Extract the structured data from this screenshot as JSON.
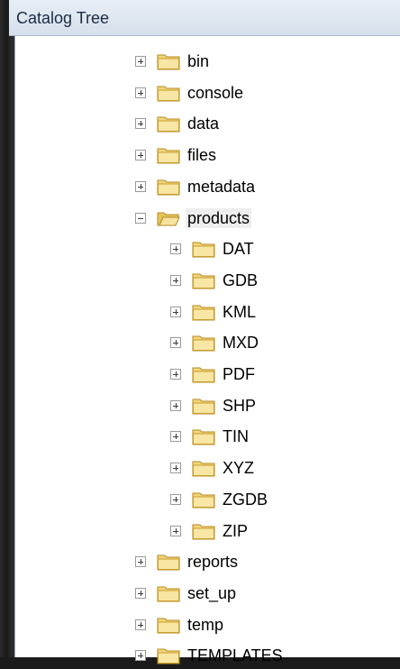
{
  "header": {
    "title": "Catalog Tree"
  },
  "tree": {
    "items": [
      {
        "label": "bin",
        "expanded": false,
        "level": 0,
        "selected": false
      },
      {
        "label": "console",
        "expanded": false,
        "level": 0,
        "selected": false
      },
      {
        "label": "data",
        "expanded": false,
        "level": 0,
        "selected": false
      },
      {
        "label": "files",
        "expanded": false,
        "level": 0,
        "selected": false
      },
      {
        "label": "metadata",
        "expanded": false,
        "level": 0,
        "selected": false
      },
      {
        "label": "products",
        "expanded": true,
        "level": 0,
        "selected": true
      },
      {
        "label": "DAT",
        "expanded": false,
        "level": 1,
        "selected": false
      },
      {
        "label": "GDB",
        "expanded": false,
        "level": 1,
        "selected": false
      },
      {
        "label": "KML",
        "expanded": false,
        "level": 1,
        "selected": false
      },
      {
        "label": "MXD",
        "expanded": false,
        "level": 1,
        "selected": false
      },
      {
        "label": "PDF",
        "expanded": false,
        "level": 1,
        "selected": false
      },
      {
        "label": "SHP",
        "expanded": false,
        "level": 1,
        "selected": false
      },
      {
        "label": "TIN",
        "expanded": false,
        "level": 1,
        "selected": false
      },
      {
        "label": "XYZ",
        "expanded": false,
        "level": 1,
        "selected": false
      },
      {
        "label": "ZGDB",
        "expanded": false,
        "level": 1,
        "selected": false
      },
      {
        "label": "ZIP",
        "expanded": false,
        "level": 1,
        "selected": false
      },
      {
        "label": "reports",
        "expanded": false,
        "level": 0,
        "selected": false
      },
      {
        "label": "set_up",
        "expanded": false,
        "level": 0,
        "selected": false
      },
      {
        "label": "temp",
        "expanded": false,
        "level": 0,
        "selected": false
      },
      {
        "label": "TEMPLATES",
        "expanded": false,
        "level": 0,
        "selected": false
      }
    ]
  },
  "icons": {
    "folder_closed": "folder-icon",
    "folder_open": "folder-open-icon",
    "expand": "plus-box-icon",
    "collapse": "minus-box-icon"
  }
}
